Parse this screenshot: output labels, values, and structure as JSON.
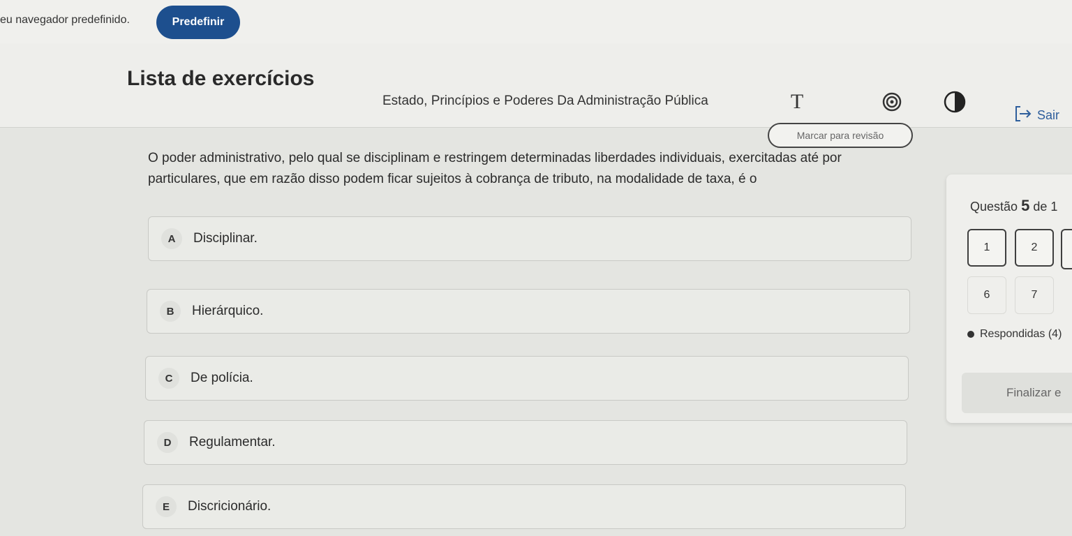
{
  "notice": {
    "text": "eu navegador predefinido.",
    "button_label": "Predefinir"
  },
  "header": {
    "title": "Lista de exercícios",
    "subject": "Estado, Princípios e Poderes Da Administração Pública",
    "font_icon_glyph": "T",
    "exit_label": "Sair",
    "review_label": "Marcar para revisão"
  },
  "question": {
    "text": "O poder administrativo, pelo qual se disciplinam e restringem determinadas liberdades individuais, exercitadas até por particulares, que em razão disso podem ficar sujeitos à cobrança de tributo, na modalidade de taxa, é o",
    "options": [
      {
        "letter": "A",
        "text": "Disciplinar."
      },
      {
        "letter": "B",
        "text": "Hierárquico."
      },
      {
        "letter": "C",
        "text": "De polícia."
      },
      {
        "letter": "D",
        "text": "Regulamentar."
      },
      {
        "letter": "E",
        "text": "Discricionário."
      }
    ]
  },
  "navigator": {
    "label_prefix": "Questão",
    "current": "5",
    "label_suffix": "de 1",
    "buttons_row1": [
      "1",
      "2"
    ],
    "buttons_row2": [
      "6",
      "7"
    ],
    "legend": "Respondidas (4)",
    "finish_label": "Finalizar e"
  },
  "colors": {
    "accent": "#1d4f8e",
    "link": "#2e5e9c",
    "background": "#e4e5e1"
  }
}
